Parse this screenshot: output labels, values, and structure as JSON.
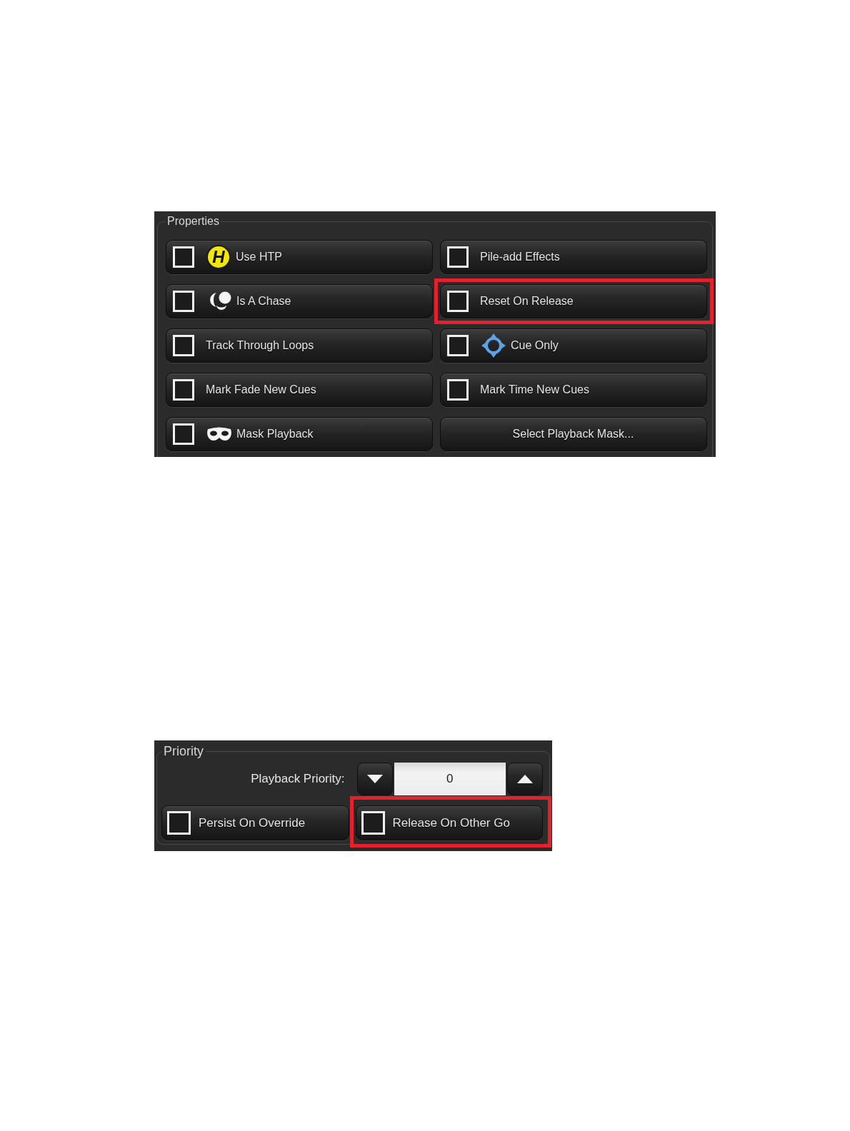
{
  "properties": {
    "title": "Properties",
    "items": [
      {
        "kind": "checkbox",
        "label": "Use HTP",
        "badge": "H",
        "checked": false,
        "highlighted": false
      },
      {
        "kind": "checkbox",
        "label": "Pile-add Effects",
        "checked": false,
        "highlighted": false
      },
      {
        "kind": "checkbox",
        "label": "Is A Chase",
        "checked": false,
        "highlighted": false
      },
      {
        "kind": "checkbox",
        "label": "Reset On Release",
        "checked": false,
        "highlighted": true
      },
      {
        "kind": "checkbox",
        "label": "Track Through Loops",
        "checked": false,
        "highlighted": false
      },
      {
        "kind": "checkbox",
        "label": "Cue Only",
        "checked": false,
        "highlighted": false
      },
      {
        "kind": "checkbox",
        "label": "Mark Fade New Cues",
        "checked": false,
        "highlighted": false
      },
      {
        "kind": "checkbox",
        "label": "Mark Time New Cues",
        "checked": false,
        "highlighted": false
      },
      {
        "kind": "checkbox",
        "label": "Mask Playback",
        "checked": false,
        "highlighted": false
      },
      {
        "kind": "button",
        "label": "Select Playback Mask...",
        "highlighted": false
      }
    ]
  },
  "priority": {
    "title": "Priority",
    "spinner": {
      "label": "Playback Priority:",
      "value": "0"
    },
    "items": [
      {
        "kind": "checkbox",
        "label": "Persist On Override",
        "checked": false,
        "highlighted": false
      },
      {
        "kind": "checkbox",
        "label": "Release On Other Go",
        "checked": false,
        "highlighted": true
      }
    ]
  }
}
